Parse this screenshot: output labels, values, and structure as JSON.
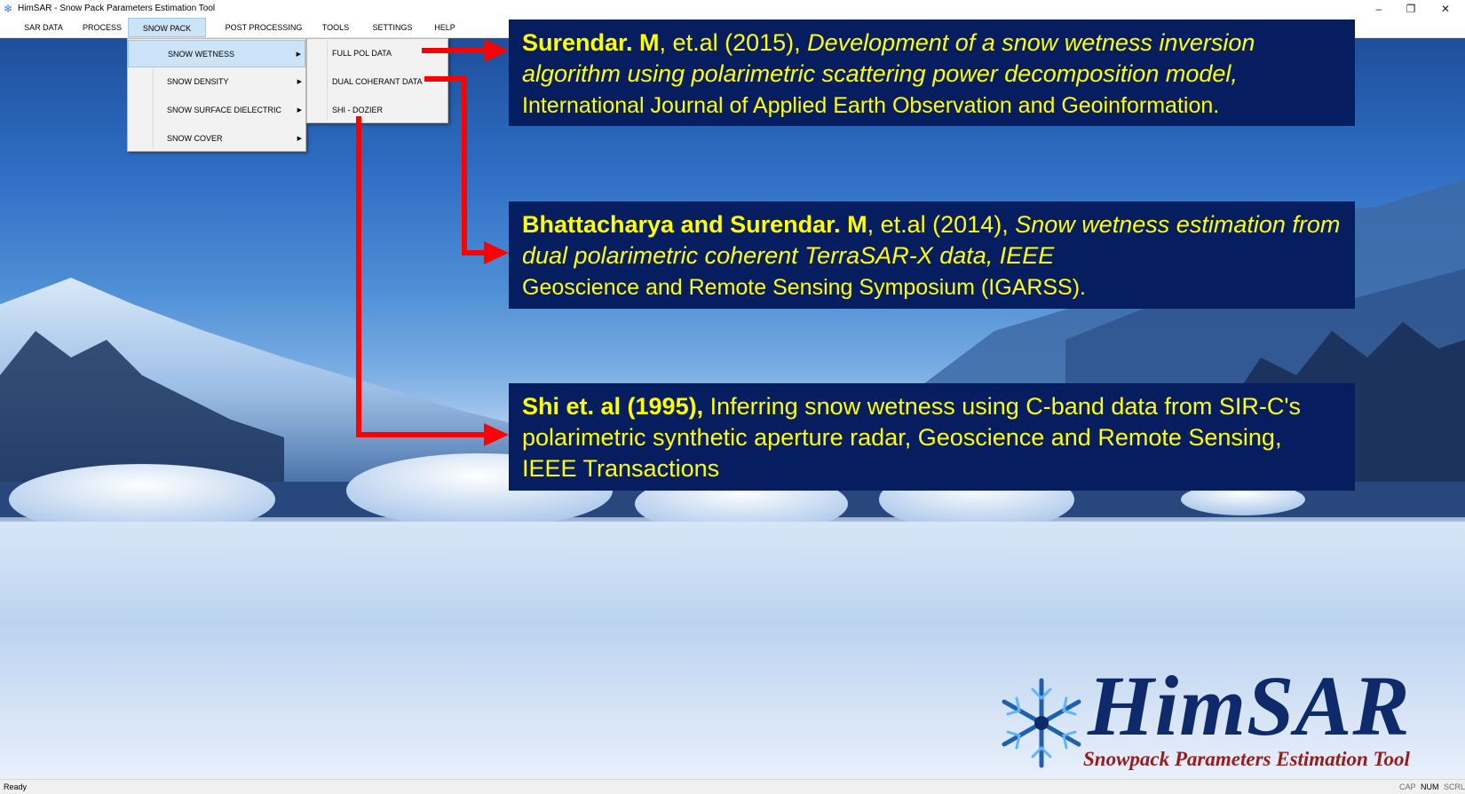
{
  "window": {
    "title": "HimSAR - Snow Pack Parameters Estimation Tool",
    "controls": {
      "minimize": "–",
      "restore": "❐",
      "close": "✕"
    }
  },
  "menubar": {
    "items": [
      "SAR DATA",
      "PROCESS",
      "SNOW PACK",
      "POST PROCESSING",
      "TOOLS",
      "SETTINGS",
      "HELP"
    ],
    "active": "SNOW PACK"
  },
  "snowpack_menu": {
    "items": [
      "SNOW WETNESS",
      "SNOW DENSITY",
      "SNOW SURFACE DIELECTRIC",
      "SNOW COVER"
    ],
    "highlighted": "SNOW WETNESS"
  },
  "wetness_submenu": {
    "items": [
      "FULL POL DATA",
      "DUAL COHERANT DATA",
      "SHI - DOZIER"
    ]
  },
  "references": [
    {
      "authors": "Surendar. M",
      "year_text": ", et.al (2015), ",
      "title": "Development of a snow wetness inversion algorithm using polarimetric scattering power  decomposition model,",
      "venue": "International Journal of Applied Earth Observation and Geoinformation."
    },
    {
      "authors": "Bhattacharya and Surendar. M",
      "year_text": ", et.al (2014), ",
      "title": "Snow wetness estimation from dual polarimetric coherent TerraSAR-X data, IEEE",
      "venue": "Geoscience and Remote Sensing Symposium (IGARSS)."
    },
    {
      "authors": "Shi et. al (1995),",
      "year_text": " ",
      "title": "Inferring snow wetness using C-band data from SIR-C's polarimetric synthetic aperture radar, Geoscience and Remote Sensing, IEEE Transactions",
      "venue": ""
    }
  ],
  "logo": {
    "title": "HimSAR",
    "subtitle": "Snowpack Parameters Estimation Tool"
  },
  "statusbar": {
    "status": "Ready",
    "indicators": [
      "CAP",
      "NUM",
      "SCRL"
    ],
    "active_indicator": "NUM"
  },
  "colors": {
    "ref_box_bg": "#061d5f",
    "ref_text": "#ffff00",
    "arrow": "#ff0000",
    "logo_title": "#0f2a6b",
    "logo_subtitle": "#9a1b1b"
  }
}
